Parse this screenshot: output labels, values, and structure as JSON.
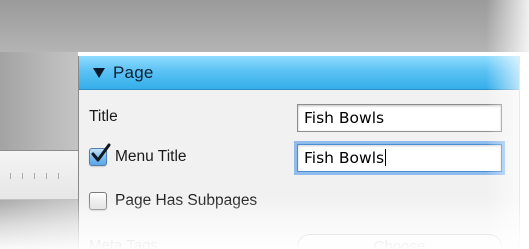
{
  "panel": {
    "title": "Page",
    "fields": {
      "title_label": "Title",
      "title_value": "Fish Bowls",
      "menu_title_label": "Menu Title",
      "menu_title_checked": true,
      "menu_title_value": "Fish Bowls",
      "subpages_label": "Page Has Subpages",
      "subpages_checked": false,
      "meta_tags_label": "Meta Tags",
      "choose_label": "Choose"
    }
  },
  "icons": {
    "disclosure": "disclosure-triangle-down-icon",
    "checkmark": "checkmark-icon"
  },
  "colors": {
    "header_accent": "#34aeea",
    "focus_ring": "#5aa0eb",
    "checkbox_checked": "#5aa6e8"
  }
}
